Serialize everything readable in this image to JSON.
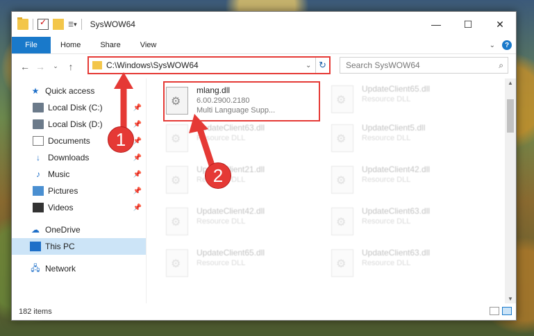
{
  "window": {
    "title": "SysWOW64"
  },
  "ribbon": {
    "tabs": [
      "File",
      "Home",
      "Share",
      "View"
    ]
  },
  "address": {
    "path": "C:\\Windows\\SysWOW64"
  },
  "search": {
    "placeholder": "Search SysWOW64"
  },
  "nav": {
    "quick_access": "Quick access",
    "items": [
      "Local Disk (C:)",
      "Local Disk (D:)",
      "Documents",
      "Downloads",
      "Music",
      "Pictures",
      "Videos"
    ],
    "onedrive": "OneDrive",
    "thispc": "This PC",
    "network": "Network"
  },
  "files": {
    "highlighted": {
      "name": "mlang.dll",
      "version": "6.00.2900.2180",
      "desc": "Multi Language Supp..."
    },
    "right_col": [
      {
        "name": "UpdateClient65.dll",
        "desc": "Resource DLL"
      },
      {
        "name": "UpdateClient5.dll",
        "desc": "Resource DLL"
      },
      {
        "name": "UpdateClient42.dll",
        "desc": "Resource DLL"
      },
      {
        "name": "UpdateClient63.dll",
        "desc": "Resource DLL"
      },
      {
        "name": "UpdateClient63.dll",
        "desc": "Resource DLL"
      }
    ],
    "left_col": [
      {
        "name": "UpdateClient63.dll",
        "desc": "Resource DLL"
      },
      {
        "name": "UpdateClient21.dll",
        "desc": "Resource DLL"
      },
      {
        "name": "UpdateClient42.dll",
        "desc": "Resource DLL"
      },
      {
        "name": "UpdateClient65.dll",
        "desc": "Resource DLL"
      }
    ]
  },
  "status": {
    "count": "182 items"
  },
  "annotations": {
    "badge1": "1",
    "badge2": "2",
    "color": "#e53935"
  },
  "icons": [
    "folder-icon",
    "properties-icon",
    "new-folder-icon",
    "back-icon",
    "forward-icon",
    "up-icon",
    "refresh-icon",
    "search-icon",
    "help-icon",
    "pin-icon",
    "gear-file-icon"
  ]
}
